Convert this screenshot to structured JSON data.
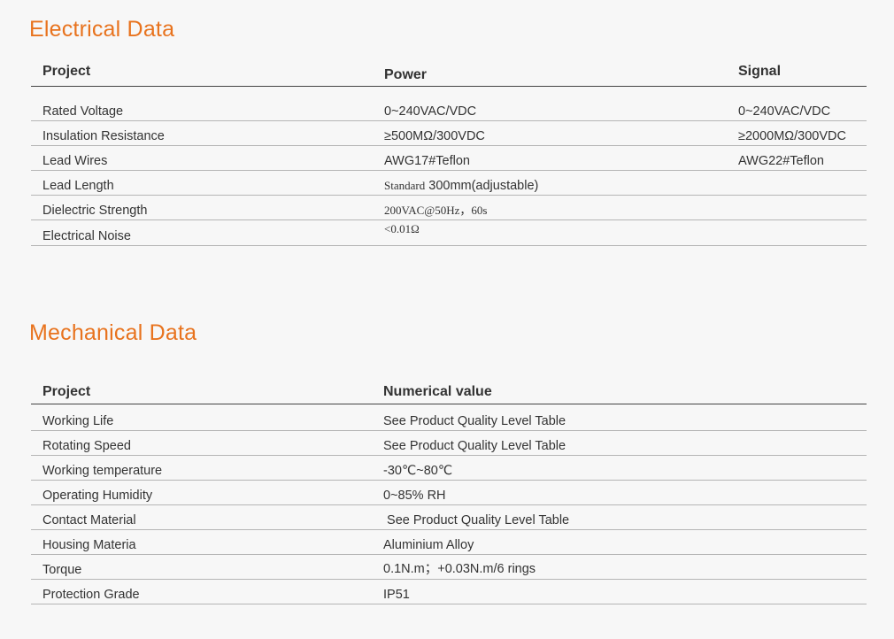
{
  "electrical": {
    "title": "Electrical Data",
    "headers": {
      "project": "Project",
      "power": "Power",
      "signal": "Signal"
    },
    "rows": [
      {
        "project": "Rated Voltage",
        "power": "0~240VAC/VDC",
        "signal": "0~240VAC/VDC"
      },
      {
        "project": "Insulation Resistance",
        "power": "≥500MΩ/300VDC",
        "signal": "≥2000MΩ/300VDC"
      },
      {
        "project": "Lead Wires",
        "power": "AWG17#Teflon",
        "signal": "AWG22#Teflon"
      },
      {
        "project": "Lead Length",
        "power_prefix": "Standard",
        "power": "300mm(adjustable)",
        "signal": ""
      },
      {
        "project": "Dielectric Strength",
        "power": "200VAC@50Hz，60s",
        "signal": ""
      },
      {
        "project": "Electrical Noise",
        "power": "<0.01Ω",
        "signal": ""
      }
    ]
  },
  "mechanical": {
    "title": "Mechanical Data",
    "headers": {
      "project": "Project",
      "value": "Numerical value"
    },
    "rows": [
      {
        "project": "Working Life",
        "value": "See Product Quality Level Table"
      },
      {
        "project": "Rotating Speed",
        "value": "See Product Quality Level Table"
      },
      {
        "project": "Working temperature",
        "value": "-30℃~80℃"
      },
      {
        "project": "Operating Humidity",
        "value": "0~85% RH"
      },
      {
        "project": "Contact Material",
        "value": " See Product Quality Level Table"
      },
      {
        "project": "Housing Materia",
        "value": "Aluminium Alloy"
      },
      {
        "project": "Torque",
        "value": "0.1N.m；+0.03N.m/6 rings"
      },
      {
        "project": "Protection Grade",
        "value": "IP51"
      }
    ]
  }
}
